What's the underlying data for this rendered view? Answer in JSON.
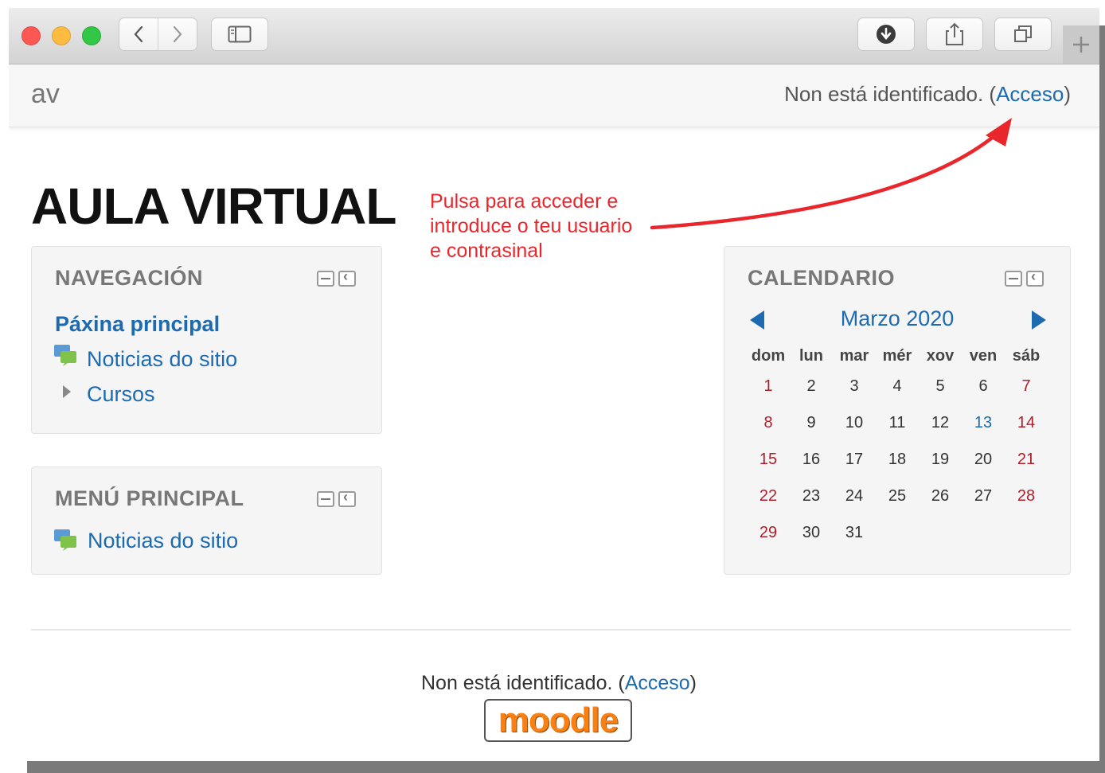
{
  "header": {
    "brand": "av",
    "login_text": "Non está identificado. (",
    "login_link": "Acceso",
    "login_close": ")"
  },
  "site_title": "AULA VIRTUAL",
  "annotation": {
    "line1": "Pulsa para acceder e",
    "line2": "introduce o teu usuario",
    "line3": "e contrasinal",
    "arrow_color": "#e8262c"
  },
  "navigation": {
    "title": "NAVEGACIÓN",
    "items": [
      {
        "label": "Páxina principal"
      },
      {
        "label": "Noticias do sitio"
      },
      {
        "label": "Cursos"
      }
    ]
  },
  "main_menu": {
    "title": "MENÚ PRINCIPAL",
    "items": [
      {
        "label": "Noticias do sitio"
      }
    ]
  },
  "calendar": {
    "title": "CALENDARIO",
    "month": "Marzo 2020",
    "weekdays": [
      "dom",
      "lun",
      "mar",
      "mér",
      "xov",
      "ven",
      "sáb"
    ],
    "weeks": [
      [
        "1",
        "2",
        "3",
        "4",
        "5",
        "6",
        "7"
      ],
      [
        "8",
        "9",
        "10",
        "11",
        "12",
        "13",
        "14"
      ],
      [
        "15",
        "16",
        "17",
        "18",
        "19",
        "20",
        "21"
      ],
      [
        "22",
        "23",
        "24",
        "25",
        "26",
        "27",
        "28"
      ],
      [
        "29",
        "30",
        "31",
        "",
        "",
        "",
        ""
      ]
    ],
    "today": "13"
  },
  "footer": {
    "login_text": "Non está identificado. (",
    "login_link": "Acceso",
    "login_close": ")",
    "logo": "moodle"
  },
  "colors": {
    "link": "#1c6bb1",
    "weekend": "#b11d2a",
    "annotation": "#e8262c"
  }
}
